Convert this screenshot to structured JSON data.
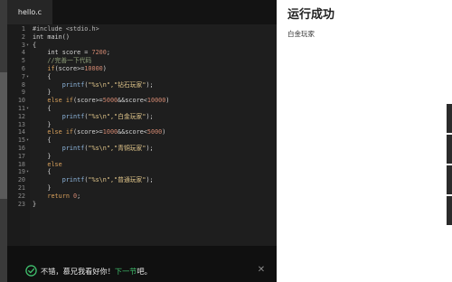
{
  "editor": {
    "tab_label": "hello.c",
    "code_lines": [
      {
        "n": "1",
        "fold": "",
        "html": "<span class=\"pp\">#include &lt;stdio.h&gt;</span>"
      },
      {
        "n": "2",
        "fold": "",
        "html": "int main()"
      },
      {
        "n": "3",
        "fold": "▾",
        "html": "{"
      },
      {
        "n": "4",
        "fold": "",
        "html": "    int score = <span class=\"num\">7200</span>;"
      },
      {
        "n": "5",
        "fold": "",
        "html": "    <span class=\"cmt\">//完善一下代码</span>"
      },
      {
        "n": "6",
        "fold": "",
        "html": "    <span class=\"kw\">if</span>(score&gt;=<span class=\"num\">10000</span>)"
      },
      {
        "n": "7",
        "fold": "▾",
        "html": "    {"
      },
      {
        "n": "8",
        "fold": "",
        "html": "        <span class=\"fn\">printf</span>(<span class=\"str\">\"%s\\n\",\"钻石玩家\"</span>);"
      },
      {
        "n": "9",
        "fold": "",
        "html": "    }"
      },
      {
        "n": "10",
        "fold": "",
        "html": "    <span class=\"kw\">else if</span>(score&gt;=<span class=\"num\">5000</span>&amp;&amp;score&lt;<span class=\"num\">10000</span>)"
      },
      {
        "n": "11",
        "fold": "▾",
        "html": "    {"
      },
      {
        "n": "12",
        "fold": "",
        "html": "        <span class=\"fn\">printf</span>(<span class=\"str\">\"%s\\n\",\"白金玩家\"</span>);"
      },
      {
        "n": "13",
        "fold": "",
        "html": "    }"
      },
      {
        "n": "14",
        "fold": "",
        "html": "    <span class=\"kw\">else if</span>(score&gt;=<span class=\"num\">1000</span>&amp;&amp;score&lt;<span class=\"num\">5000</span>)"
      },
      {
        "n": "15",
        "fold": "▾",
        "html": "    {"
      },
      {
        "n": "16",
        "fold": "",
        "html": "        <span class=\"fn\">printf</span>(<span class=\"str\">\"%s\\n\",\"青铜玩家\"</span>);"
      },
      {
        "n": "17",
        "fold": "",
        "html": "    }"
      },
      {
        "n": "18",
        "fold": "",
        "html": "    <span class=\"kw\">else</span>"
      },
      {
        "n": "19",
        "fold": "▾",
        "html": "    {"
      },
      {
        "n": "20",
        "fold": "",
        "html": "        <span class=\"fn\">printf</span>(<span class=\"str\">\"%s\\n\",\"普通玩家\"</span>);"
      },
      {
        "n": "21",
        "fold": "",
        "html": "    }"
      },
      {
        "n": "22",
        "fold": "",
        "html": "    <span class=\"kw\">return</span> <span class=\"num\">0</span>;"
      },
      {
        "n": "23",
        "fold": "",
        "html": "}"
      }
    ]
  },
  "feedback": {
    "text_before": "不错，慕兄我看好你！",
    "link_text": "下一节",
    "text_after": "吧。",
    "icon": "check-circle-icon",
    "close_icon": "close-icon"
  },
  "result": {
    "title": "运行成功",
    "output": "白金玩家"
  },
  "colors": {
    "editor_bg": "#1e1e1e",
    "accent_green": "#3fbe6c",
    "keyword": "#d9a15c",
    "string": "#e0c58a"
  }
}
